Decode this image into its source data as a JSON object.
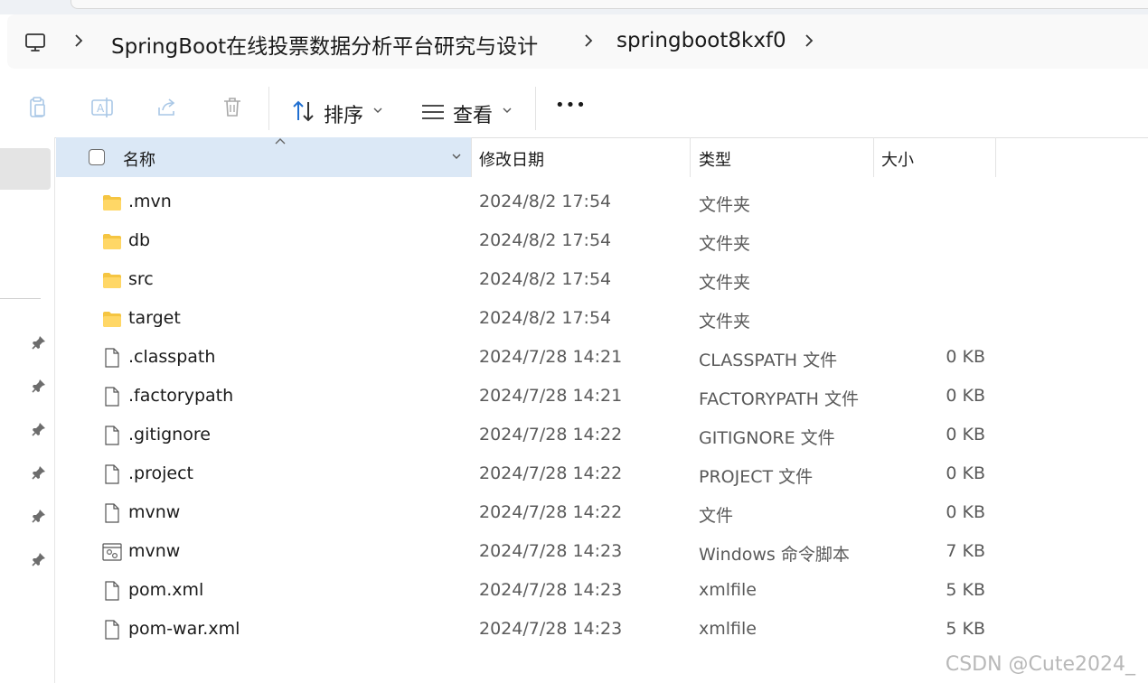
{
  "address_bar": {
    "crumbs": [
      "SpringBoot在线投票数据分析平台研究与设计",
      "springboot8kxf0"
    ]
  },
  "toolbar": {
    "sort_label": "排序",
    "view_label": "查看",
    "more_label": "•••"
  },
  "columns": {
    "name": "名称",
    "modified": "修改日期",
    "type": "类型",
    "size": "大小"
  },
  "files": [
    {
      "icon": "folder-icon",
      "name": ".mvn",
      "modified": "2024/8/2 17:54",
      "type": "文件夹",
      "size": ""
    },
    {
      "icon": "folder-icon",
      "name": "db",
      "modified": "2024/8/2 17:54",
      "type": "文件夹",
      "size": ""
    },
    {
      "icon": "folder-icon",
      "name": "src",
      "modified": "2024/8/2 17:54",
      "type": "文件夹",
      "size": ""
    },
    {
      "icon": "folder-icon",
      "name": "target",
      "modified": "2024/8/2 17:54",
      "type": "文件夹",
      "size": ""
    },
    {
      "icon": "file-icon",
      "name": ".classpath",
      "modified": "2024/7/28 14:21",
      "type": "CLASSPATH 文件",
      "size": "0 KB"
    },
    {
      "icon": "file-icon",
      "name": ".factorypath",
      "modified": "2024/7/28 14:21",
      "type": "FACTORYPATH 文件",
      "size": "0 KB"
    },
    {
      "icon": "file-icon",
      "name": ".gitignore",
      "modified": "2024/7/28 14:22",
      "type": "GITIGNORE 文件",
      "size": "0 KB"
    },
    {
      "icon": "file-icon",
      "name": ".project",
      "modified": "2024/7/28 14:22",
      "type": "PROJECT 文件",
      "size": "0 KB"
    },
    {
      "icon": "file-icon",
      "name": "mvnw",
      "modified": "2024/7/28 14:22",
      "type": "文件",
      "size": "0 KB"
    },
    {
      "icon": "script-file-icon",
      "name": "mvnw",
      "modified": "2024/7/28 14:23",
      "type": "Windows 命令脚本",
      "size": "7 KB"
    },
    {
      "icon": "file-icon",
      "name": "pom.xml",
      "modified": "2024/7/28 14:23",
      "type": "xmlfile",
      "size": "5 KB"
    },
    {
      "icon": "file-icon",
      "name": "pom-war.xml",
      "modified": "2024/7/28 14:23",
      "type": "xmlfile",
      "size": "5 KB"
    }
  ],
  "watermark": "CSDN @Cute2024_",
  "colors": {
    "header_selected_bg": "#dbe8f6",
    "folder_yellow": "#f5c542",
    "sort_arrow_blue": "#1f6fd1",
    "secondary_text": "#5a5a5a"
  }
}
